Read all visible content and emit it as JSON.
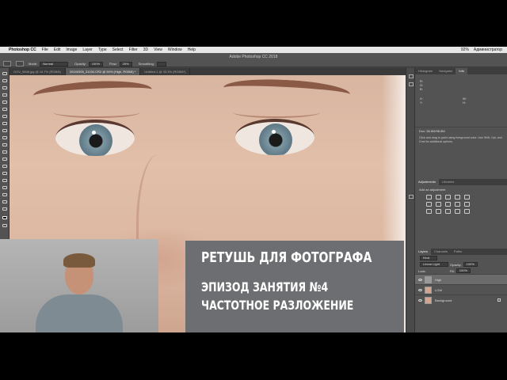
{
  "menubar": {
    "apple": "",
    "app": "Photoshop CC",
    "items": [
      "File",
      "Edit",
      "Image",
      "Layer",
      "Type",
      "Select",
      "Filter",
      "3D",
      "View",
      "Window",
      "Help"
    ],
    "right": [
      "92%",
      "Администратор"
    ]
  },
  "titlebar": {
    "title": "Adobe Photoshop CC 2018"
  },
  "options": {
    "mode_label": "Mode:",
    "mode_value": "Normal",
    "opacity_label": "Opacity:",
    "opacity_value": "100%",
    "flow_label": "Flow:",
    "flow_value": "25%",
    "smoothing_label": "Smoothing:"
  },
  "tabs": [
    "GOV_9846.jpg @ 16.7% (RGB/8)",
    "20140305_31034.CR2 @ 50% (High, RGB/8) *",
    "Untitled-1 @ 33.3% (RGB/8*)"
  ],
  "card": {
    "line1": "РЕТУШЬ ДЛЯ ФОТОГРАФА",
    "line2": "ЭПИЗОД ЗАНЯТИЯ №4",
    "line3": "ЧАСТОТНОЕ РАЗЛОЖЕНИЕ"
  },
  "info_panel": {
    "tabs": [
      "Histogram",
      "Navigator",
      "Info"
    ],
    "r": "R:",
    "g": "G:",
    "b": "B:",
    "x": "X:",
    "y": "Y:",
    "w": "W:",
    "h": "H:",
    "doc": "Doc: 58.8M/98.8M",
    "hint": "Click and drag to paint using foreground color. Use Shift, Opt, and Cmd for additional options."
  },
  "adjustments": {
    "tabs": [
      "Adjustments",
      "Libraries"
    ],
    "title": "Add an adjustment"
  },
  "layers": {
    "tabs": [
      "Layers",
      "Channels",
      "Paths"
    ],
    "kind": "Kind",
    "blend": "Linear Light",
    "opacity_label": "Opacity:",
    "opacity_value": "100%",
    "lock_label": "Lock:",
    "fill_label": "Fill:",
    "fill_value": "100%",
    "items": [
      {
        "name": "High",
        "thumb": "gray",
        "selected": true
      },
      {
        "name": "LOW",
        "thumb": "face",
        "selected": false
      },
      {
        "name": "Background",
        "thumb": "face",
        "selected": false,
        "locked": true
      }
    ]
  }
}
